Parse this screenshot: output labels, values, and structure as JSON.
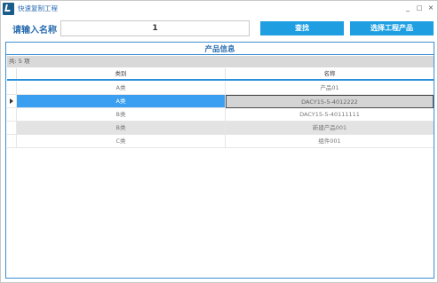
{
  "window": {
    "title": "快速复制工程",
    "icon": "app-logo-icon",
    "controls": {
      "minimize": "_",
      "maximize": "□",
      "close": "×"
    }
  },
  "search": {
    "label": "请输入名称",
    "value": "1"
  },
  "buttons": {
    "find": "查找",
    "select_product": "选择工程产品"
  },
  "panel": {
    "title": "产品信息",
    "count_text": "共: 5 项"
  },
  "table": {
    "columns": [
      "类别",
      "名称"
    ],
    "rows": [
      {
        "type": "A类",
        "name": "产品01"
      },
      {
        "type": "A类",
        "name": "DACY15-5-4012222"
      },
      {
        "type": "B类",
        "name": "DACY15-5-40111111"
      },
      {
        "type": "B类",
        "name": "新建产品001"
      },
      {
        "type": "C类",
        "name": "组件001"
      }
    ],
    "selected_row": 1
  },
  "colors": {
    "accent": "#1f9fe2",
    "title_text": "#2a6db0",
    "selection": "#3a9ff0"
  }
}
